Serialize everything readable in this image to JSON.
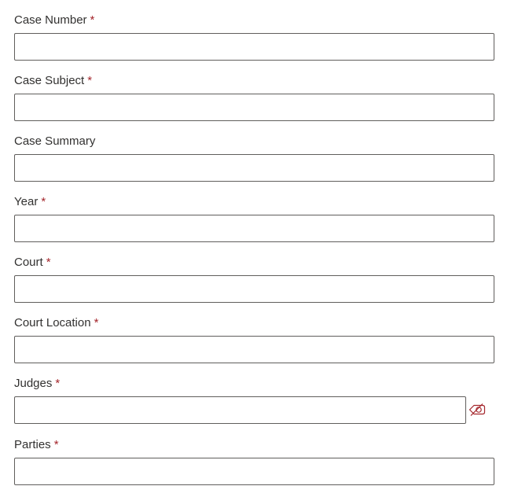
{
  "form": {
    "fields": [
      {
        "label": "Case Number",
        "required_mark": "*",
        "value": "",
        "placeholder": ""
      },
      {
        "label": "Case Subject",
        "required_mark": "*",
        "value": "",
        "placeholder": ""
      },
      {
        "label": "Case Summary",
        "required_mark": "",
        "value": "",
        "placeholder": ""
      },
      {
        "label": "Year",
        "required_mark": "*",
        "value": "",
        "placeholder": ""
      },
      {
        "label": "Court",
        "required_mark": "*",
        "value": "",
        "placeholder": ""
      },
      {
        "label": "Court Location",
        "required_mark": "*",
        "value": "",
        "placeholder": ""
      },
      {
        "label": "Judges",
        "required_mark": "*",
        "value": "",
        "placeholder": "",
        "icon": "tag-icon"
      },
      {
        "label": "Parties",
        "required_mark": "*",
        "value": "",
        "placeholder": ""
      }
    ]
  },
  "colors": {
    "label": "#323130",
    "required": "#a4262c",
    "border": "#605e5c",
    "tag_icon": "#a4262c"
  }
}
